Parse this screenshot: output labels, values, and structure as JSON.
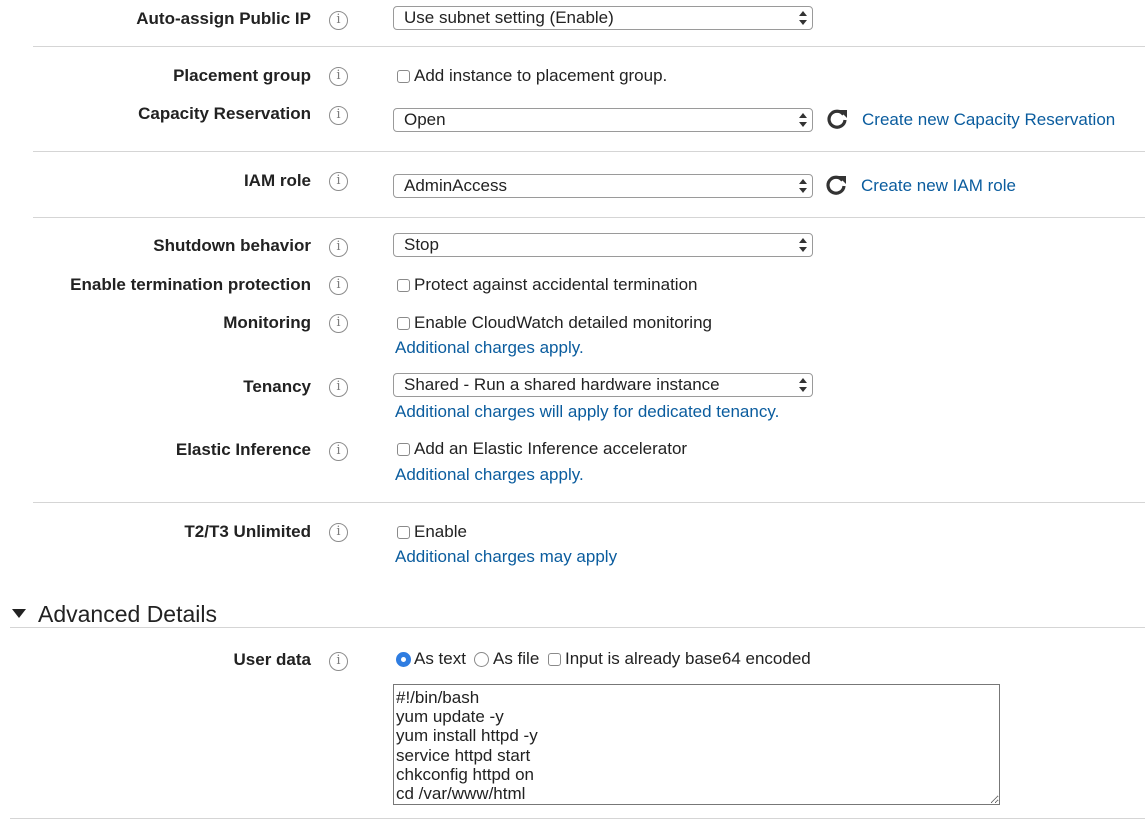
{
  "fields": {
    "auto_assign_public_ip": {
      "label": "Auto-assign Public IP",
      "value": "Use subnet setting (Enable)"
    },
    "placement_group": {
      "label": "Placement group",
      "checkbox_label": "Add instance to placement group."
    },
    "capacity_reservation": {
      "label": "Capacity Reservation",
      "value": "Open",
      "link": "Create new Capacity Reservation"
    },
    "iam_role": {
      "label": "IAM role",
      "value": "AdminAccess",
      "link": "Create new IAM role"
    },
    "shutdown_behavior": {
      "label": "Shutdown behavior",
      "value": "Stop"
    },
    "termination_protection": {
      "label": "Enable termination protection",
      "checkbox_label": "Protect against accidental termination"
    },
    "monitoring": {
      "label": "Monitoring",
      "checkbox_label": "Enable CloudWatch detailed monitoring",
      "note": "Additional charges apply."
    },
    "tenancy": {
      "label": "Tenancy",
      "value": "Shared - Run a shared hardware instance",
      "note": "Additional charges will apply for dedicated tenancy."
    },
    "elastic_inference": {
      "label": "Elastic Inference",
      "checkbox_label": "Add an Elastic Inference accelerator",
      "note": "Additional charges apply."
    },
    "t2t3_unlimited": {
      "label": "T2/T3 Unlimited",
      "checkbox_label": "Enable",
      "note": "Additional charges may apply"
    }
  },
  "advanced": {
    "heading": "Advanced Details",
    "user_data": {
      "label": "User data",
      "option_text": "As text",
      "option_file": "As file",
      "base64_label": "Input is already base64 encoded",
      "selected": "As text",
      "content": "#!/bin/bash\nyum update -y\nyum install httpd -y\nservice httpd start\nchkconfig httpd on\ncd /var/www/html"
    }
  },
  "info_icon_glyph": "i",
  "colors": {
    "link": "#0a5c9e",
    "radio_selected": "#2f7de1",
    "separator": "#d5d5d5"
  }
}
